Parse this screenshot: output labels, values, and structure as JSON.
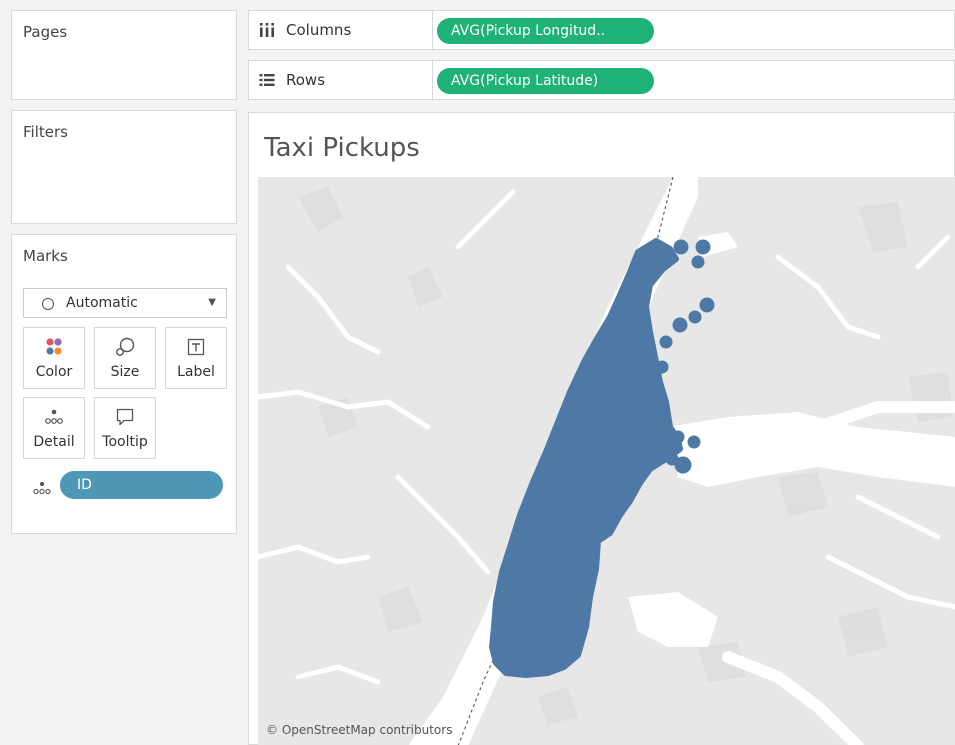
{
  "sidebar": {
    "pages": {
      "title": "Pages"
    },
    "filters": {
      "title": "Filters"
    },
    "marks": {
      "title": "Marks",
      "mark_type": "Automatic",
      "buttons": [
        {
          "label": "Color",
          "icon": "color-icon"
        },
        {
          "label": "Size",
          "icon": "size-icon"
        },
        {
          "label": "Label",
          "icon": "label-icon"
        },
        {
          "label": "Detail",
          "icon": "detail-icon"
        },
        {
          "label": "Tooltip",
          "icon": "tooltip-icon"
        }
      ],
      "field_pill": {
        "label": "ID",
        "encoding": "detail-icon",
        "color": "#4f97b6"
      }
    }
  },
  "shelves": {
    "columns": {
      "label": "Columns",
      "icon": "columns-icon",
      "pill": "AVG(Pickup Longitud..",
      "pill_color": "#1fb277"
    },
    "rows": {
      "label": "Rows",
      "icon": "rows-icon",
      "pill": "AVG(Pickup Latitude)",
      "pill_color": "#1fb277"
    }
  },
  "viz": {
    "title": "Taxi Pickups",
    "attribution": "© OpenStreetMap contributors",
    "mark_color": "#4e79a7",
    "map_land_color": "#e7e7e7",
    "map_water_color": "#ffffff"
  }
}
